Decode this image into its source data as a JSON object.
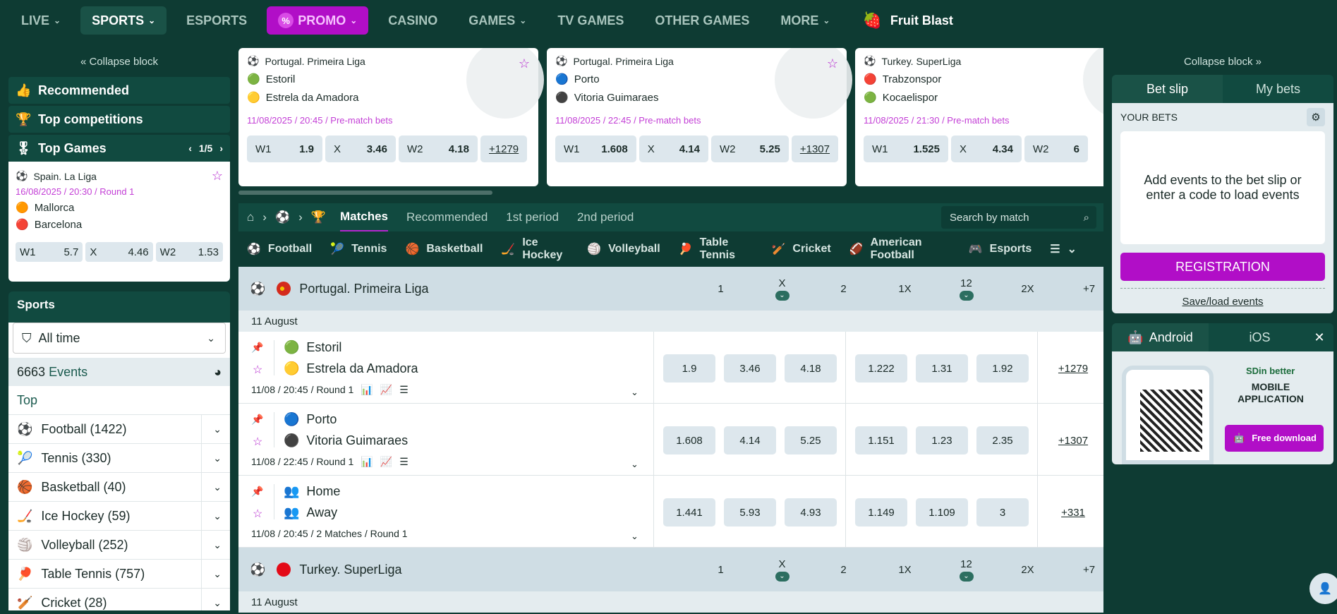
{
  "nav": {
    "items": [
      {
        "label": "LIVE"
      },
      {
        "label": "SPORTS"
      },
      {
        "label": "ESPORTS"
      },
      {
        "label": "PROMO"
      },
      {
        "label": "CASINO"
      },
      {
        "label": "GAMES"
      },
      {
        "label": "TV GAMES"
      },
      {
        "label": "OTHER GAMES"
      },
      {
        "label": "MORE"
      }
    ],
    "brand": "Fruit Blast"
  },
  "left": {
    "collapse": "Collapse block",
    "recommended": "Recommended",
    "top_competitions": "Top competitions",
    "top_games": "Top Games",
    "pager": "1/5",
    "game": {
      "league": "Spain. La Liga",
      "date": "16/08/2025 / 20:30 / Round 1",
      "team1": "Mallorca",
      "team2": "Barcelona",
      "odds": [
        {
          "label": "W1",
          "value": "5.7"
        },
        {
          "label": "X",
          "value": "4.46"
        },
        {
          "label": "W2",
          "value": "1.53"
        }
      ]
    },
    "sports_title": "Sports",
    "filter": "All time",
    "events_count": "6663",
    "events_label": "Events",
    "top": "Top",
    "sports": [
      {
        "label": "Football (1422)"
      },
      {
        "label": "Tennis (330)"
      },
      {
        "label": "Basketball (40)"
      },
      {
        "label": "Ice Hockey (59)"
      },
      {
        "label": "Volleyball (252)"
      },
      {
        "label": "Table Tennis (757)"
      },
      {
        "label": "Cricket (28)"
      }
    ]
  },
  "cards": [
    {
      "league": "Portugal. Primeira Liga",
      "team1": "Estoril",
      "team2": "Estrela da Amadora",
      "date": "11/08/2025 / 20:45 / Pre-match bets",
      "w1": "1.9",
      "x": "3.46",
      "w2": "4.18",
      "more": "+1279"
    },
    {
      "league": "Portugal. Primeira Liga",
      "team1": "Porto",
      "team2": "Vitoria Guimaraes",
      "date": "11/08/2025 / 22:45 / Pre-match bets",
      "w1": "1.608",
      "x": "4.14",
      "w2": "5.25",
      "more": "+1307"
    },
    {
      "league": "Turkey. SuperLiga",
      "team1": "Trabzonspor",
      "team2": "Kocaelispor",
      "date": "11/08/2025 / 21:30 / Pre-match bets",
      "w1": "1.525",
      "x": "4.34",
      "w2": "6",
      "more": ""
    }
  ],
  "odd_labels": {
    "w1": "W1",
    "x": "X",
    "w2": "W2"
  },
  "matchbar": {
    "tabs": [
      "Matches",
      "Recommended",
      "1st period",
      "2nd period"
    ],
    "search_placeholder": "Search by match"
  },
  "sportsbar": [
    "Football",
    "Tennis",
    "Basketball",
    "Ice Hockey",
    "Volleyball",
    "Table Tennis",
    "Cricket",
    "American Football",
    "Esports"
  ],
  "columns": [
    "1",
    "X",
    "2",
    "1X",
    "12",
    "2X",
    "+7"
  ],
  "leagues": [
    {
      "name": "Portugal. Primeira Liga",
      "date": "11 August",
      "matches": [
        {
          "team1": "Estoril",
          "team2": "Estrela da Amadora",
          "info": "11/08 / 20:45 / Round 1",
          "odds": [
            "1.9",
            "3.46",
            "4.18",
            "1.222",
            "1.31",
            "1.92"
          ],
          "more": "+1279"
        },
        {
          "team1": "Porto",
          "team2": "Vitoria Guimaraes",
          "info": "11/08 / 22:45 / Round 1",
          "odds": [
            "1.608",
            "4.14",
            "5.25",
            "1.151",
            "1.23",
            "2.35"
          ],
          "more": "+1307"
        },
        {
          "team1": "Home",
          "team2": "Away",
          "info": "11/08 / 20:45 / 2 Matches / Round 1",
          "odds": [
            "1.441",
            "5.93",
            "4.93",
            "1.149",
            "1.109",
            "3"
          ],
          "more": "+331"
        }
      ]
    },
    {
      "name": "Turkey. SuperLiga",
      "date": "11 August"
    }
  ],
  "right": {
    "collapse": "Collapse block",
    "tab_betslip": "Bet slip",
    "tab_mybets": "My bets",
    "your_bets": "YOUR BETS",
    "empty": "Add events to the bet slip or enter a code to load events",
    "registration": "REGISTRATION",
    "saveload": "Save/load events",
    "android": "Android",
    "ios": "iOS",
    "app_brand": "SDin better",
    "app_title": "MOBILE APPLICATION",
    "free_download": "Free download"
  }
}
